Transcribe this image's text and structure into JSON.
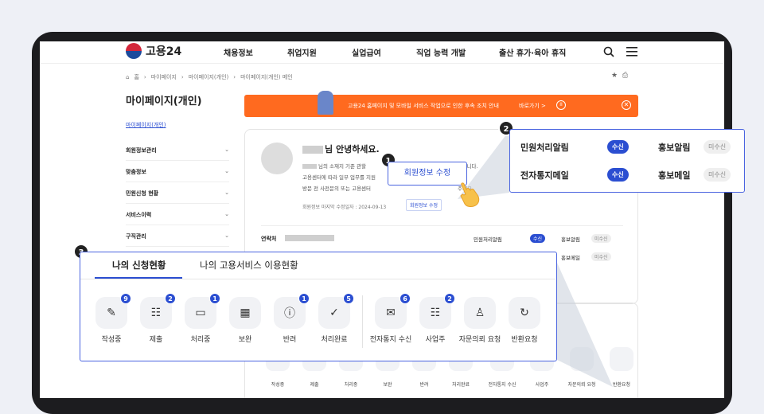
{
  "nav": {
    "logo_text": "고용24",
    "menu": [
      "채용정보",
      "취업지원",
      "실업급여",
      "직업 능력 개발",
      "출산 휴가·육아 휴직"
    ]
  },
  "breadcrumb": [
    "홈",
    "마이페이지",
    "마이페이지(개인)",
    "마이페이지(개인) 메인"
  ],
  "sidebar": {
    "title": "마이페이지(개인)",
    "sub": "마이페이지(개인)",
    "items": [
      "회원정보관리",
      "맞춤정보",
      "민원신청 현황",
      "서비스이력",
      "구직관리"
    ]
  },
  "banner": {
    "text": "고용24 홈페이지 및 모바일 서비스 작업으로 인한 후속 조치 안내",
    "more": "바로가기 >",
    "pause": "II",
    "close": "✕"
  },
  "profile": {
    "greeting": "님 안녕하세요.",
    "line1_a": "님의 소재지 기준 관할",
    "line1_b": "4-7301)입니다.",
    "line2": "고용센터에 따라 일부 업무를 지원",
    "line3_a": "방문 전 사전문의 또는 고용센터",
    "line3_b": "주세요.",
    "edit_date": "회원정보 마지막 수정일자 : 2024-09-13",
    "edit_button": "회원정보 수정",
    "contact_label": "연락처",
    "notify_rows": [
      {
        "label": "민원처리알림",
        "status": "수신",
        "label2": "홍보알림",
        "status2": "미수신"
      },
      {
        "label": "",
        "status": "",
        "label2": "홍보메일",
        "status2": "미수신"
      }
    ]
  },
  "callout1": {
    "number": "1",
    "text": "회원정보 수정"
  },
  "callout2": {
    "number": "2",
    "rows": [
      {
        "label": "민원처리알림",
        "status": "수신",
        "label2": "홍보알림",
        "status2": "미수신"
      },
      {
        "label": "전자통지메일",
        "status": "수신",
        "label2": "홍보메일",
        "status2": "미수신"
      }
    ]
  },
  "callout3": {
    "number": "3",
    "tabs": [
      "나의 신청현황",
      "나의 고용서비스 이용현황"
    ],
    "items": [
      {
        "label": "작성중",
        "badge": "9",
        "icon": "pencil-icon",
        "glyph": "✎"
      },
      {
        "label": "제출",
        "badge": "2",
        "icon": "document-icon",
        "glyph": "☷"
      },
      {
        "label": "처리중",
        "badge": "1",
        "icon": "chat-icon",
        "glyph": "▭"
      },
      {
        "label": "보완",
        "badge": "",
        "icon": "grid-icon",
        "glyph": "▦"
      },
      {
        "label": "반려",
        "badge": "1",
        "icon": "alert-icon",
        "glyph": "ⓘ"
      },
      {
        "label": "처리완료",
        "badge": "5",
        "icon": "check-icon",
        "glyph": "✓"
      },
      {
        "label": "전자통지 수신",
        "badge": "6",
        "icon": "inbox-icon",
        "glyph": "✉"
      },
      {
        "label": "사업주",
        "badge": "2",
        "icon": "briefcase-icon",
        "glyph": "☷"
      },
      {
        "label": "자문의뢰 요청",
        "badge": "",
        "icon": "person-edit-icon",
        "glyph": "♙"
      },
      {
        "label": "반환요청",
        "badge": "",
        "icon": "return-icon",
        "glyph": "↻"
      }
    ]
  },
  "bottom_labels": [
    "작성중",
    "제출",
    "처리중",
    "보완",
    "반려",
    "처리완료",
    "전자통지 수신",
    "사업주",
    "자문의뢰 요청",
    "반환요청"
  ]
}
